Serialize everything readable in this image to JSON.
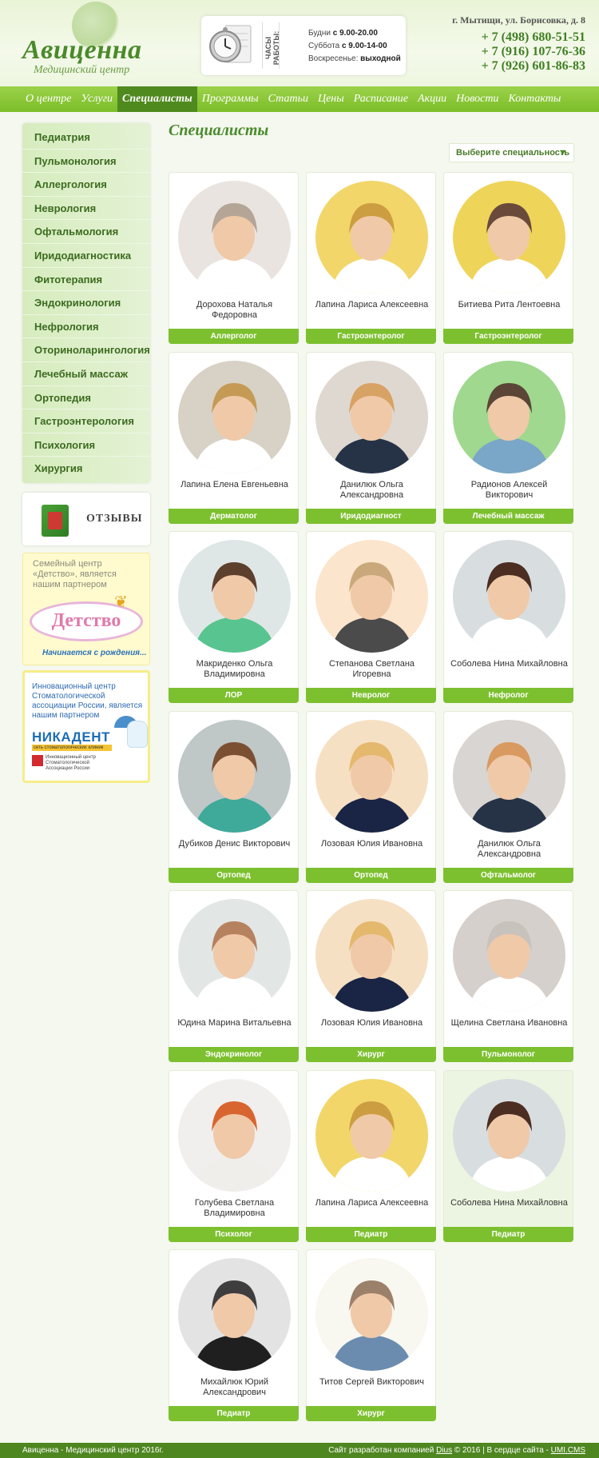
{
  "header": {
    "logo_title": "Авиценна",
    "logo_subtitle": "Медицинский центр",
    "hours_title": "ЧАСЫ РАБОТЫ:",
    "hours": [
      {
        "label": "Будни",
        "value": "с 9.00-20.00"
      },
      {
        "label": "Суббота",
        "value": "с 9.00-14-00"
      },
      {
        "label": "Воскресенье:",
        "value": "выходной"
      }
    ],
    "address": "г. Мытищи, ул. Борисовка, д. 8",
    "phones": [
      "+ 7 (498) 680-51-51",
      "+ 7 (916) 107-76-36",
      "+ 7 (926) 601-86-83"
    ]
  },
  "nav": {
    "items": [
      "О центре",
      "Услуги",
      "Специалисты",
      "Программы",
      "Статьи",
      "Цены",
      "Расписание",
      "Акции",
      "Новости",
      "Контакты"
    ],
    "active_index": 2
  },
  "sidebar": {
    "menu": [
      "Педиатрия",
      "Пульмонология",
      "Аллергология",
      "Неврология",
      "Офтальмология",
      "Иридодиагностика",
      "Фитотерапия",
      "Эндокринология",
      "Нефрология",
      "Оториноларингология",
      "Лечебный массаж",
      "Ортопедия",
      "Гастроэнтерология",
      "Психология",
      "Хирургия"
    ],
    "reviews_label": "ОТЗЫВЫ",
    "partner1": {
      "text": "Семейный центр «Детство», является нашим партнером",
      "logo": "Детство",
      "slogan": "Начинается с рождения..."
    },
    "partner2": {
      "text": "Инновационный центр Стоматологической ассоциации России, является нашим партнером",
      "logo": "НИКАДЕНТ",
      "logo_sub": "сеть стоматологических клиник",
      "innov": "Инновационный центр Стоматологической Ассоциации России"
    }
  },
  "main": {
    "title": "Специалисты",
    "select_placeholder": "Выберите специальность",
    "specialists": [
      {
        "name": "Дорохова Наталья Федоровна",
        "spec": "Аллерголог"
      },
      {
        "name": "Лапина Лариса Алексеевна",
        "spec": "Гастроэнтеролог"
      },
      {
        "name": "Битиева Рита Лентоевна",
        "spec": "Гастроэнтеролог"
      },
      {
        "name": "Лапина Елена Евгеньевна",
        "spec": "Дерматолог"
      },
      {
        "name": "Данилюк Ольга Александровна",
        "spec": "Иридодиагност"
      },
      {
        "name": "Радионов Алексей Викторович",
        "spec": "Лечебный массаж"
      },
      {
        "name": "Макриденко Ольга Владимировна",
        "spec": "ЛОР"
      },
      {
        "name": "Степанова Светлана Игоревна",
        "spec": "Невролог"
      },
      {
        "name": "Соболева Нина Михайловна",
        "spec": "Нефролог"
      },
      {
        "name": "Дубиков Денис Викторович",
        "spec": "Ортопед"
      },
      {
        "name": "Лозовая Юлия Ивановна",
        "spec": "Ортопед"
      },
      {
        "name": "Данилюк Ольга Александровна",
        "spec": "Офтальмолог"
      },
      {
        "name": "Юдина Марина Витальевна",
        "spec": "Эндокринолог"
      },
      {
        "name": "Лозовая Юлия Ивановна",
        "spec": "Хирург"
      },
      {
        "name": "Щелина Светлана Ивановна",
        "spec": "Пульмонолог"
      },
      {
        "name": "Голубева Светлана Владимировна",
        "spec": "Психолог"
      },
      {
        "name": "Лапина Лариса Алексеевна",
        "spec": "Педиатр"
      },
      {
        "name": "Соболева Нина Михайловна",
        "spec": "Педиатр"
      },
      {
        "name": "Михайлюк Юрий Александрович",
        "spec": "Педиатр"
      },
      {
        "name": "Титов Сергей Викторович",
        "spec": "Хирург"
      }
    ]
  },
  "footer": {
    "left": "Авиценна - Медицинский центр 2016г.",
    "right_prefix": "Сайт разработан компанией",
    "company": "Dius",
    "right_mid": "© 2016 | В сердце сайта -",
    "cms": "UMI.CMS"
  }
}
